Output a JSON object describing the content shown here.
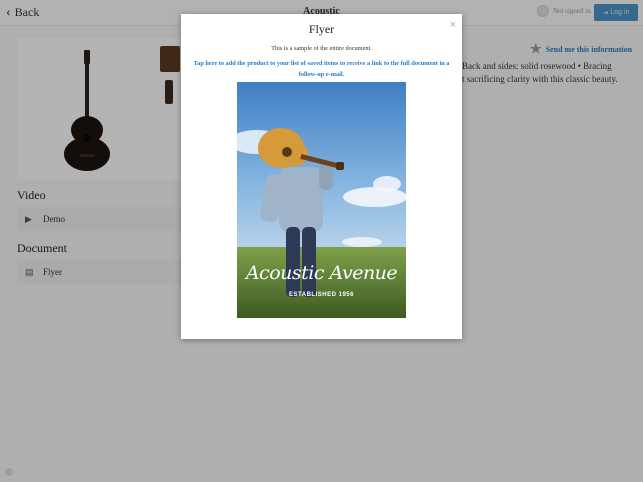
{
  "header": {
    "back_label": "Back",
    "title": "Acoustic",
    "signin_text": "Not signed in",
    "login_label": "Log in"
  },
  "product": {
    "send_info_label": "Send me this information",
    "description_line1": "Back and sides: solid rosewood • Bracing",
    "description_line2": "t sacrificing clarity with this classic beauty."
  },
  "video": {
    "heading": "Video",
    "items": [
      {
        "label": "Demo",
        "icon": "play-icon"
      }
    ]
  },
  "document": {
    "heading": "Document",
    "items": [
      {
        "label": "Flyer",
        "icon": "document-icon"
      }
    ]
  },
  "modal": {
    "title": "Flyer",
    "close_glyph": "×",
    "subtitle": "This is a sample of the entire document.",
    "link_text": "Tap here to add the product to your list of saved items to receive a link to the full document in a follow-up e-mail.",
    "flyer_title": "Acoustic Avenue",
    "flyer_subtitle": "ESTABLISHED 1956"
  },
  "colors": {
    "accent": "#2a7bbf",
    "login_button": "#4a90c2",
    "overlay": "rgba(0,0,0,0.28)"
  }
}
